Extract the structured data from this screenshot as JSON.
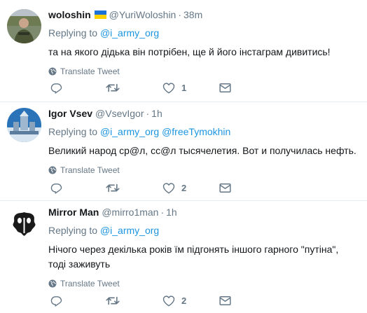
{
  "tweets": [
    {
      "name": "woloshin",
      "has_flag": true,
      "handle": "@YuriWoloshin",
      "time": "38m",
      "replying_label": "Replying to",
      "mentions": [
        "@i_army_org"
      ],
      "text": "та на якого дідька він потрібен, ще й його інстаграм дивитись!",
      "translate": "Translate Tweet",
      "likes": "1"
    },
    {
      "name": "Igor Vsev",
      "has_flag": false,
      "handle": "@VsevIgor",
      "time": "1h",
      "replying_label": "Replying to",
      "mentions": [
        "@i_army_org",
        "@freeTymokhin"
      ],
      "text": "Великий народ ср@л, сс@л тысячелетия. Вот и получилась нефть.",
      "translate": "Translate Tweet",
      "likes": "2"
    },
    {
      "name": "Mirror Man",
      "has_flag": false,
      "handle": "@mirro1man",
      "time": "1h",
      "replying_label": "Replying to",
      "mentions": [
        "@i_army_org"
      ],
      "text": "Нічого через декілька років їм підгонять іншого гарного \"путіна\", тоді заживуть",
      "translate": "Translate Tweet",
      "likes": "2"
    }
  ],
  "icons": {
    "reply": "reply-icon",
    "retweet": "retweet-icon",
    "like": "heart-icon",
    "dm": "envelope-icon",
    "globe": "globe-icon"
  },
  "colors": {
    "link": "#1b95e0",
    "secondary": "#657786",
    "text": "#14171a",
    "flag_blue": "#1c72d6",
    "flag_yellow": "#ffd200"
  }
}
